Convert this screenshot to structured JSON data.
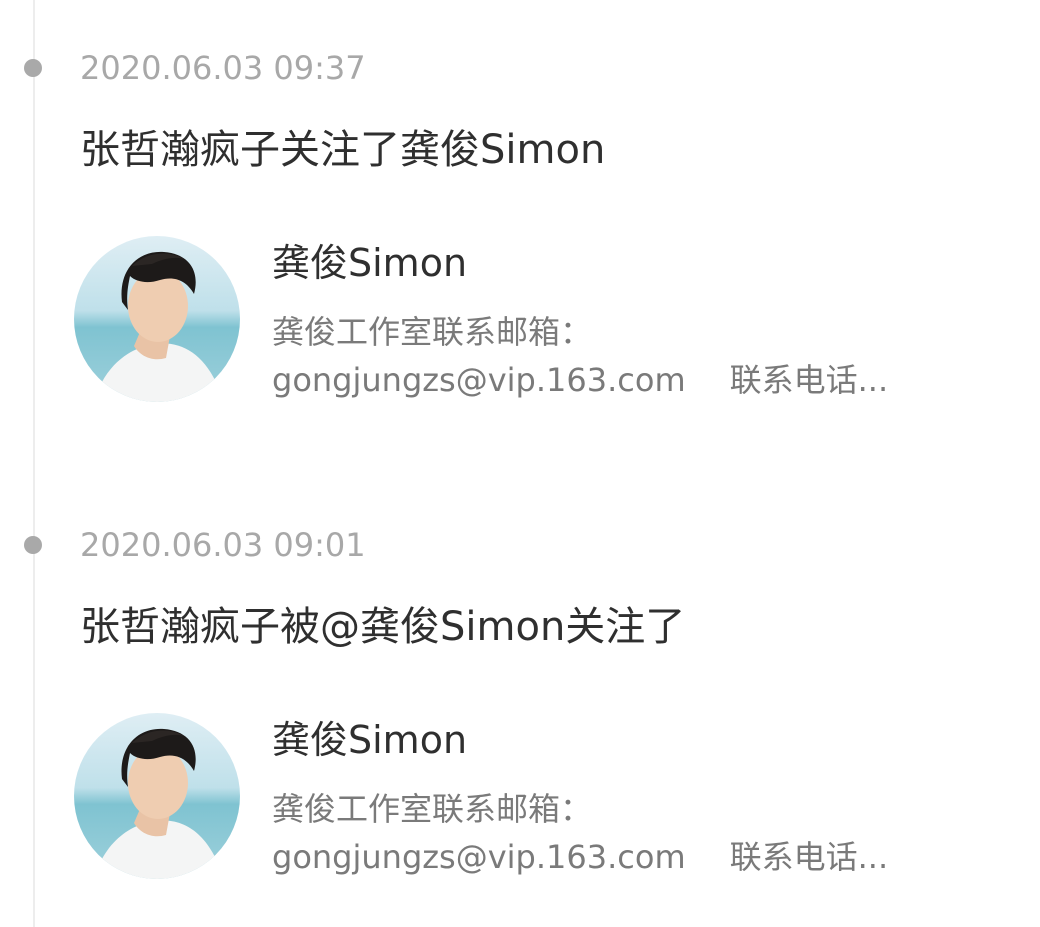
{
  "feed": {
    "items": [
      {
        "timestamp": "2020.06.03 09:37",
        "action": "张哲瀚疯子关注了龚俊Simon",
        "card": {
          "name": "龚俊Simon",
          "bio_line1": "龚俊工作室联系邮箱：",
          "bio_email": "gongjungzs@vip.163.com",
          "bio_phone": "联系电话...",
          "avatar_icon": "profile-photo"
        }
      },
      {
        "timestamp": "2020.06.03 09:01",
        "action": "张哲瀚疯子被@龚俊Simon关注了",
        "card": {
          "name": "龚俊Simon",
          "bio_line1": "龚俊工作室联系邮箱：",
          "bio_email": "gongjungzs@vip.163.com",
          "bio_phone": "联系电话...",
          "avatar_icon": "profile-photo"
        }
      }
    ]
  },
  "colors": {
    "timestamp": "#a8a8a8",
    "primary_text": "#2f2f2f",
    "secondary_text": "#7a7a7a",
    "timeline_dot": "#a9a9a9",
    "timeline_line": "#ededed"
  }
}
